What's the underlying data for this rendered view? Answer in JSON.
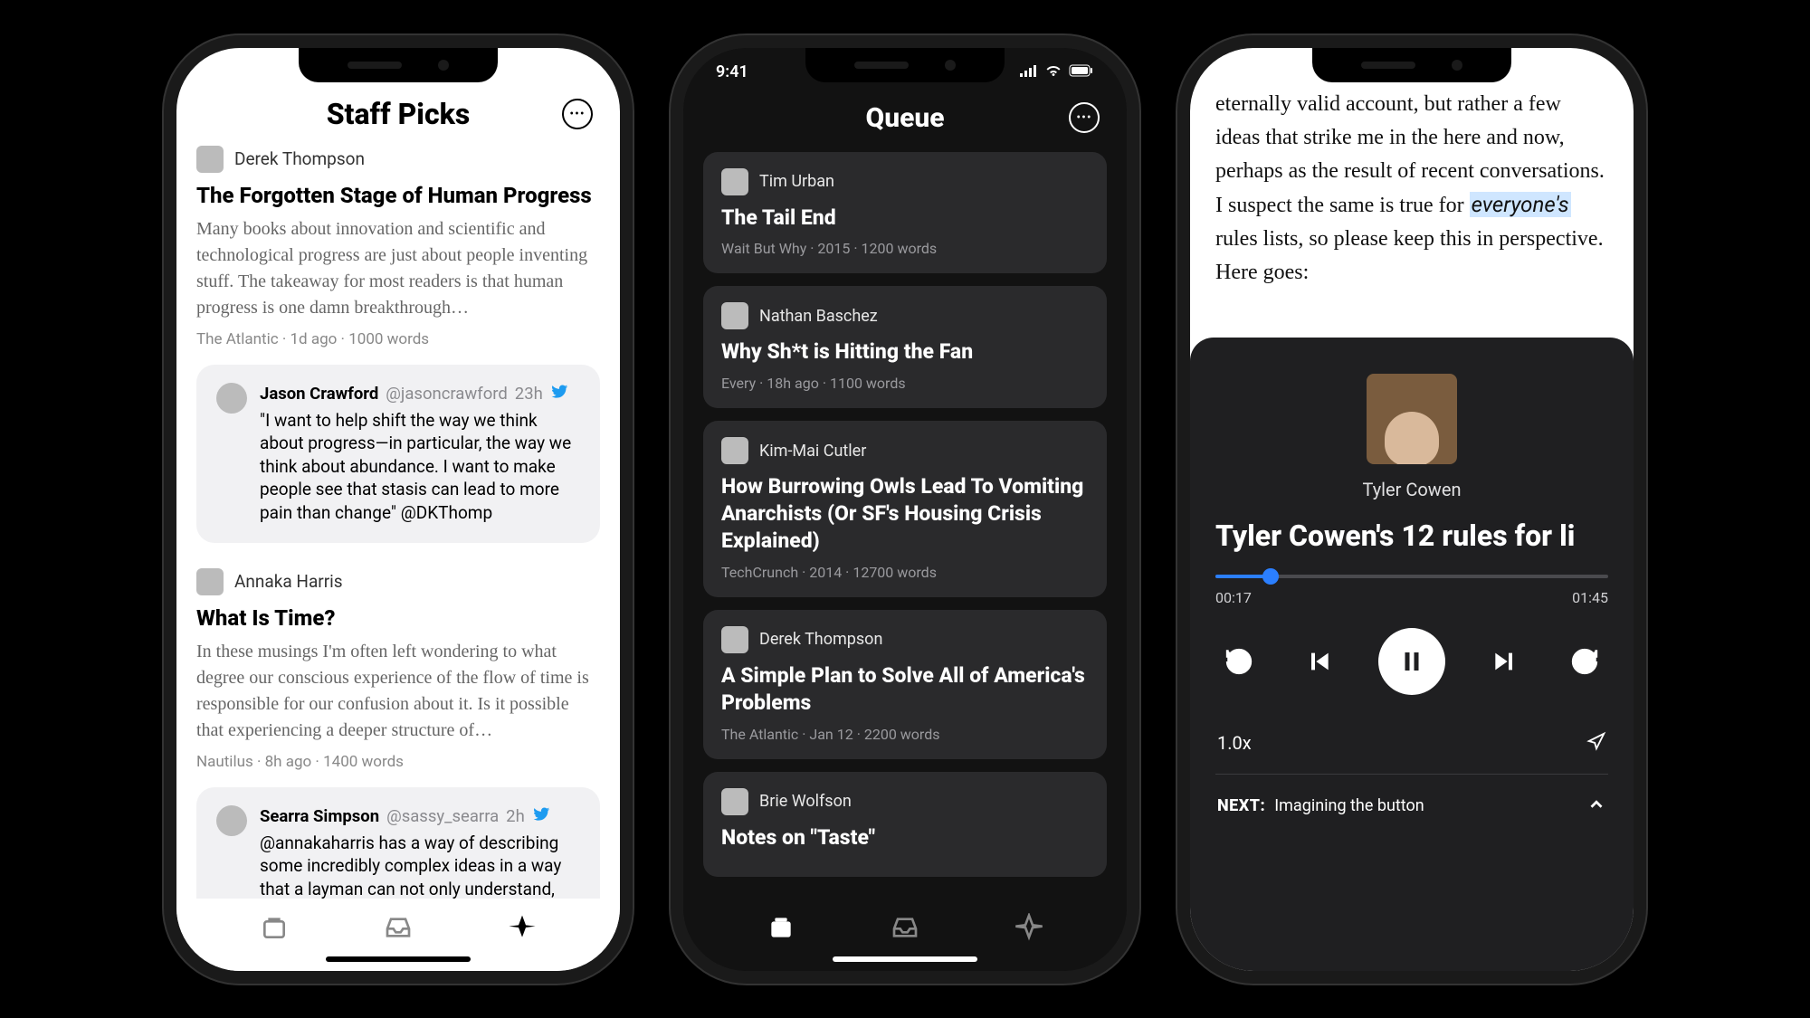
{
  "phone1": {
    "header": {
      "title": "Staff Picks"
    },
    "articles": [
      {
        "author": "Derek Thompson",
        "title": "The Forgotten Stage of Human Progress",
        "excerpt": "Many books about innovation and scientific and technological progress are just about people inventing stuff. The takeaway for most readers is that human progress is one damn breakthrough…",
        "meta": "The Atlantic · 1d ago · 1000 words",
        "quote": {
          "name": "Jason Crawford",
          "handle": "@jasoncrawford",
          "time": "23h",
          "text": "\"I want to help shift the way we think about progress—in particular, the way we think about abundance. I want to make people see that stasis can lead to more pain than change\" @DKThomp"
        }
      },
      {
        "author": "Annaka Harris",
        "title": "What Is Time?",
        "excerpt": "In these musings I'm often left wondering to what degree our conscious experience of the flow of time is responsible for our confusion about it. Is it possible that experiencing a deeper structure of…",
        "meta": "Nautilus · 8h ago · 1400 words",
        "quote": {
          "name": "Searra Simpson",
          "handle": "@sassy_searra",
          "time": "2h",
          "text": "@annakaharris has a way of describing some incredibly complex ideas in a way that a layman can not only understand, but"
        }
      }
    ]
  },
  "phone2": {
    "status": {
      "time": "9:41"
    },
    "header": {
      "title": "Queue"
    },
    "items": [
      {
        "author": "Tim Urban",
        "title": "The Tail End",
        "meta": "Wait But Why · 2015 · 1200 words"
      },
      {
        "author": "Nathan Baschez",
        "title": "Why Sh*t is Hitting the Fan",
        "meta": "Every · 18h ago · 1100 words"
      },
      {
        "author": "Kim-Mai Cutler",
        "title": "How Burrowing Owls Lead To Vomiting Anarchists (Or SF's Housing Crisis Explained)",
        "meta": "TechCrunch · 2014 · 12700 words"
      },
      {
        "author": "Derek Thompson",
        "title": "A Simple Plan to Solve All of America's Problems",
        "meta": "The Atlantic · Jan 12 · 2200 words"
      },
      {
        "author": "Brie Wolfson",
        "title": "Notes on \"Taste\"",
        "meta": ""
      }
    ]
  },
  "phone3": {
    "reader_html": "eternally valid account, but rather a few ideas that strike me in the here and now, perhaps as the result of recent conversations. I suspect the same is true for <em>everyone's</em> rules lists, so please keep this in perspective. Here goes:",
    "player": {
      "author": "Tyler Cowen",
      "title": "Tyler Cowen's 12 rules for li",
      "elapsed": "00:17",
      "total": "01:45",
      "rate": "1.0x",
      "next_label": "NEXT:",
      "next_title": "Imagining the button"
    }
  }
}
